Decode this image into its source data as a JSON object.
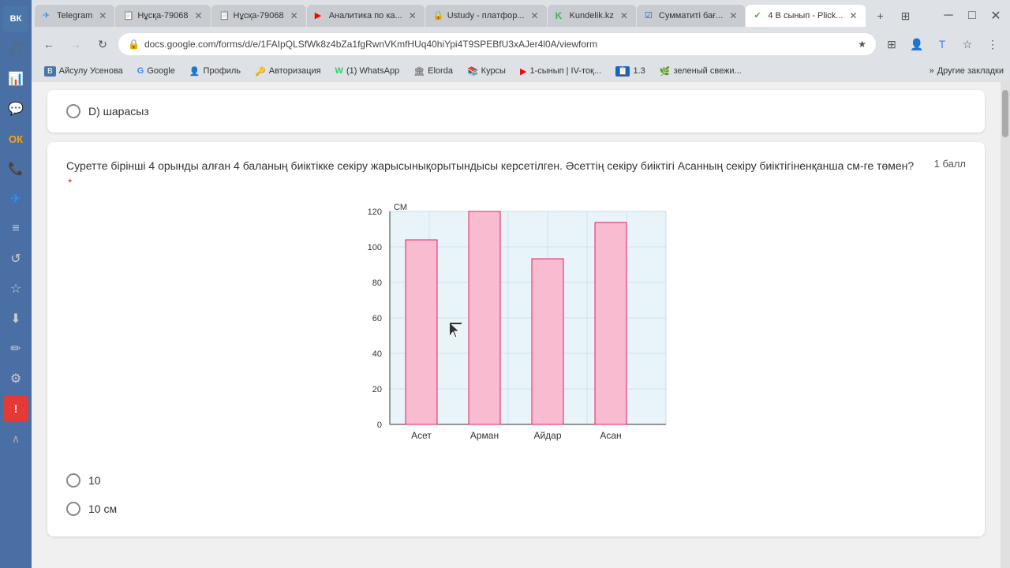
{
  "browser": {
    "tabs": [
      {
        "id": "telegram",
        "icon": "✈",
        "title": "Telegram",
        "active": false,
        "color": "#2196f3"
      },
      {
        "id": "nusqa1",
        "icon": "📄",
        "title": "Нұсқа-79068",
        "active": false,
        "color": "#4285f4"
      },
      {
        "id": "nusqa2",
        "icon": "📄",
        "title": "Нұсқа-79068",
        "active": false,
        "color": "#4285f4"
      },
      {
        "id": "analytics",
        "icon": "▶",
        "title": "Аналитика по ка...",
        "active": false,
        "color": "#ff0000"
      },
      {
        "id": "ustudy",
        "icon": "🔒",
        "title": "Ustudy - платфор...",
        "active": false,
        "color": "#00bcd4"
      },
      {
        "id": "kundelik",
        "icon": "K",
        "title": "Kundelik.kz",
        "active": false,
        "color": "#4caf50"
      },
      {
        "id": "summative",
        "icon": "☑",
        "title": "Сумматиті бағ...",
        "active": false,
        "color": "#1565c0"
      },
      {
        "id": "4b",
        "icon": "✔",
        "title": "4 В сынып - Plick...",
        "active": true,
        "color": "#4caf50"
      }
    ],
    "address": "docs.google.com/forms/d/e/1FAIpQLSfWk8z4bZa1fgRwnVKmfHUq40hiYpi4T9SPEBfU3xAJer4l0A/viewform",
    "bookmarks": [
      {
        "icon": "В",
        "label": "Айсулу Усенова",
        "color": "#4a76a8"
      },
      {
        "icon": "G",
        "label": "Google",
        "color": "#4285f4"
      },
      {
        "icon": "👤",
        "label": "Профиль"
      },
      {
        "icon": "🔑",
        "label": "Авторизация"
      },
      {
        "icon": "W",
        "label": "(1) WhatsApp",
        "color": "#25d366"
      },
      {
        "icon": "E",
        "label": "Elorda"
      },
      {
        "icon": "📚",
        "label": "Курсы"
      },
      {
        "icon": "▶",
        "label": "1-сынып | IV-тоқ...",
        "color": "#ff0000"
      },
      {
        "icon": "1.3",
        "label": "1.3"
      },
      {
        "icon": "🌿",
        "label": "зеленый свежи..."
      }
    ]
  },
  "sidebar": {
    "icons": [
      {
        "name": "vk",
        "symbol": "ВК"
      },
      {
        "name": "music",
        "symbol": "♪"
      },
      {
        "name": "chart",
        "symbol": "📊"
      },
      {
        "name": "face",
        "symbol": "👤"
      },
      {
        "name": "ok",
        "symbol": "ОК"
      },
      {
        "name": "phone",
        "symbol": "📞"
      },
      {
        "name": "telegram",
        "symbol": "✈"
      },
      {
        "name": "list",
        "symbol": "≡"
      },
      {
        "name": "history",
        "symbol": "↺"
      },
      {
        "name": "star",
        "symbol": "☆"
      },
      {
        "name": "download",
        "symbol": "⬇"
      },
      {
        "name": "edit",
        "symbol": "✏"
      },
      {
        "name": "settings",
        "symbol": "⚙"
      },
      {
        "name": "alert",
        "symbol": "!"
      },
      {
        "name": "chevron",
        "symbol": "∧"
      }
    ]
  },
  "page": {
    "option_d_label": "D) шарасыз",
    "question2": {
      "text": "Суретте бірінші 4 орынды алған 4 баланың биіктікке секіру жарысынықорытындысы керсетілген. Әсеттің секіру биіктігі Асанның секіру биіктігіненқанша см-ге төмен?",
      "required": true,
      "points": "1 балл",
      "chart": {
        "y_axis_label": "СМ",
        "y_max": 120,
        "y_min": 0,
        "y_step": 20,
        "bars": [
          {
            "name": "Асет",
            "value": 100,
            "color": "#f8bbd0"
          },
          {
            "name": "Арман",
            "value": 120,
            "color": "#f8bbd0"
          },
          {
            "name": "Айдар",
            "value": 90,
            "color": "#f8bbd0"
          },
          {
            "name": "Асан",
            "value": 110,
            "color": "#f8bbd0"
          }
        ]
      },
      "options": [
        {
          "value": "10",
          "label": "10"
        },
        {
          "value": "10cm",
          "label": "10 см"
        }
      ]
    }
  }
}
